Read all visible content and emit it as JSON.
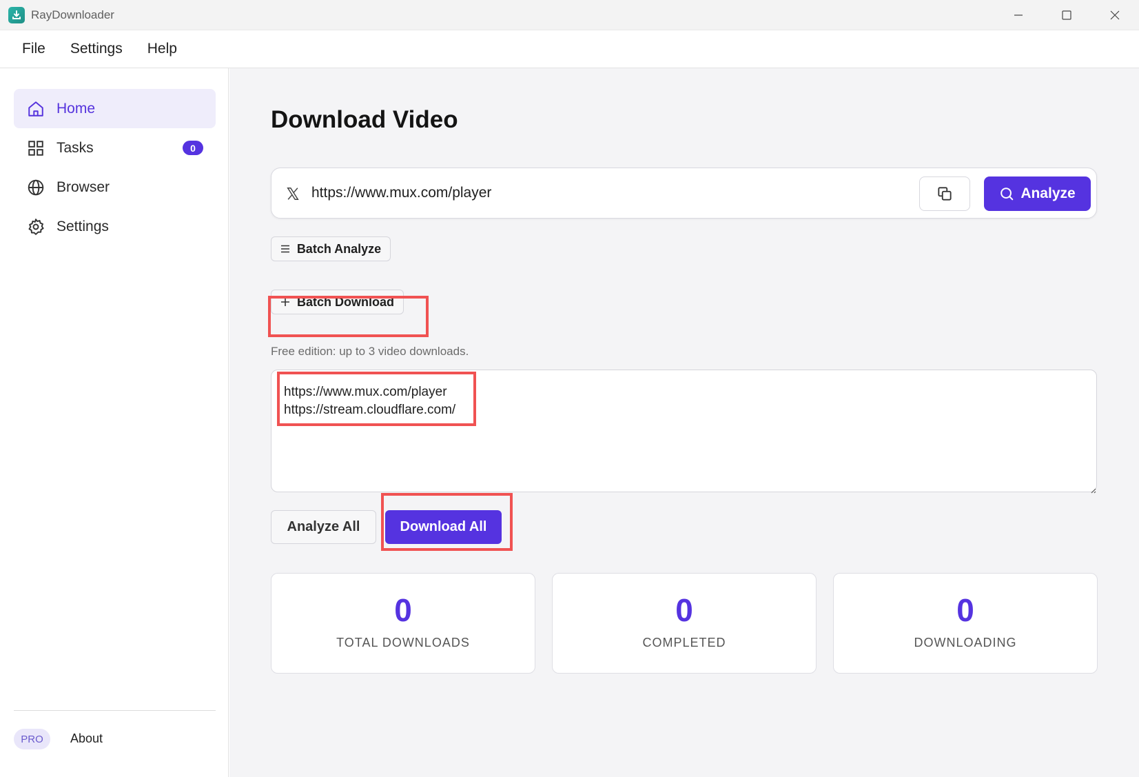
{
  "window": {
    "title": "RayDownloader"
  },
  "menu": [
    "File",
    "Settings",
    "Help"
  ],
  "sidebar": {
    "items": [
      {
        "label": "Home",
        "icon": "home-icon",
        "active": true
      },
      {
        "label": "Tasks",
        "icon": "grid-icon",
        "badge": "0"
      },
      {
        "label": "Browser",
        "icon": "globe-icon"
      },
      {
        "label": "Settings",
        "icon": "gear-icon"
      }
    ],
    "pro_label": "PRO",
    "about_label": "About"
  },
  "main": {
    "title": "Download Video",
    "url_input_value": "https://www.mux.com/player",
    "analyze_label": "Analyze",
    "batch_analyze_label": "Batch Analyze",
    "batch_download_label": "Batch Download",
    "free_note": "Free edition: up to 3 video downloads.",
    "batch_urls": "https://www.mux.com/player\nhttps://stream.cloudflare.com/",
    "analyze_all_label": "Analyze All",
    "download_all_label": "Download All",
    "stats": [
      {
        "value": "0",
        "label": "TOTAL DOWNLOADS"
      },
      {
        "value": "0",
        "label": "COMPLETED"
      },
      {
        "value": "0",
        "label": "DOWNLOADING"
      }
    ]
  },
  "colors": {
    "accent": "#5533e0",
    "active_nav_bg": "#efedfb",
    "highlight_box": "#f05252"
  }
}
